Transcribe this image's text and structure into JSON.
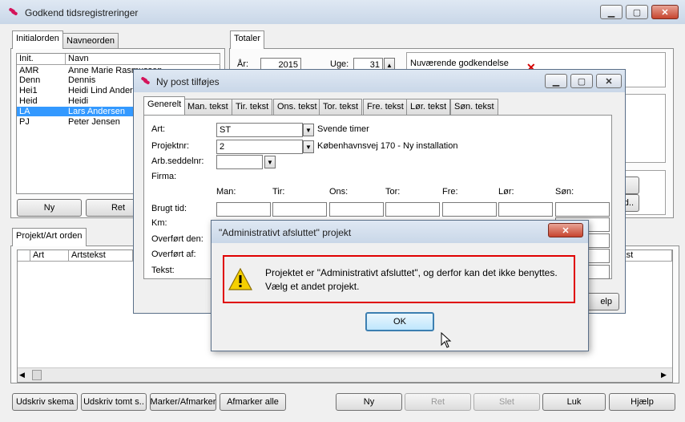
{
  "main": {
    "title": "Godkend tidsregistreringer",
    "left_tabs": [
      "Initialorden",
      "Navneorden"
    ],
    "list_headers": [
      "Init.",
      "Navn"
    ],
    "list_rows": [
      {
        "init": "AMR",
        "navn": "Anne Marie Rasmussen"
      },
      {
        "init": "Denn",
        "navn": "Dennis"
      },
      {
        "init": "Hei1",
        "navn": "Heidi Lind Andersen"
      },
      {
        "init": "Heid",
        "navn": "Heidi"
      },
      {
        "init": "LA",
        "navn": "Lars Andersen",
        "selected": true
      },
      {
        "init": "PJ",
        "navn": "Peter Jensen"
      }
    ],
    "left_buttons": {
      "ny": "Ny",
      "ret": "Ret"
    },
    "totaler_tab": "Totaler",
    "aar_label": "År:",
    "aar_value": "2015",
    "uge_label": "Uge:",
    "uge_value": "31",
    "godkendelse_label": "Nuværende godkendelse",
    "projekt_tab": "Projekt/Art orden",
    "grid_headers": [
      "Art",
      "Artstekst"
    ],
    "grid_header_right": "ekst",
    "bottom_buttons": [
      "Udskriv skema",
      "Udskriv tomt s..",
      "Marker/Afmarker",
      "Afmarker alle",
      "Ny",
      "Ret",
      "Slet",
      "Luk",
      "Hjælp"
    ],
    "partial_buttons": [
      "d..",
      "elp"
    ]
  },
  "dialog": {
    "title": "Ny post tilføjes",
    "tabs": [
      "Generelt",
      "Man. tekst",
      "Tir. tekst",
      "Ons. tekst",
      "Tor. tekst",
      "Fre. tekst",
      "Lør. tekst",
      "Søn. tekst"
    ],
    "art_label": "Art:",
    "art_value": "ST",
    "art_desc": "Svende timer",
    "projekt_label": "Projektnr:",
    "projekt_value": "2",
    "projekt_desc": "Københavnsvej 170 - Ny installation",
    "arb_label": "Arb.seddelnr:",
    "firma_label": "Firma:",
    "days": [
      "Man:",
      "Tir:",
      "Ons:",
      "Tor:",
      "Fre:",
      "Lør:",
      "Søn:"
    ],
    "row_labels": [
      "Brugt tid:",
      "Km:",
      "Overført den:",
      "Overført af:",
      "Tekst:"
    ]
  },
  "alert": {
    "title": "\"Administrativt afsluttet\" projekt",
    "message_line1": "Projektet er \"Administrativt afsluttet\", og derfor kan det ikke benyttes.",
    "message_line2": "Vælg et andet projekt.",
    "ok_label": "OK"
  },
  "colors": {
    "highlight": "#3399ff",
    "alert_border": "#e00000",
    "close_red": "#c7442e"
  }
}
